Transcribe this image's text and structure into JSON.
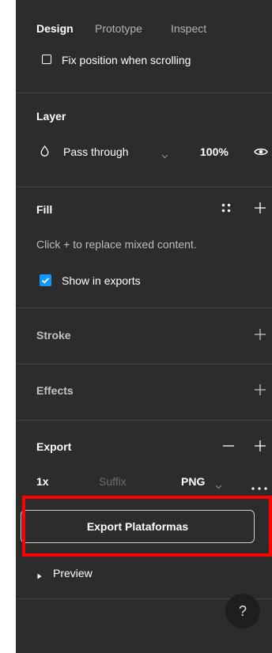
{
  "tabs": {
    "design": "Design",
    "prototype": "Prototype",
    "inspect": "Inspect"
  },
  "frame": {
    "fix_position_label": "Fix position when scrolling",
    "fix_position_checked": false
  },
  "layer": {
    "title": "Layer",
    "blend_mode": "Pass through",
    "opacity": "100%"
  },
  "fill": {
    "title": "Fill",
    "hint": "Click + to replace mixed content.",
    "show_in_exports_label": "Show in exports",
    "show_in_exports_checked": true
  },
  "stroke": {
    "title": "Stroke"
  },
  "effects": {
    "title": "Effects"
  },
  "export": {
    "title": "Export",
    "scale": "1x",
    "suffix_placeholder": "Suffix",
    "format": "PNG",
    "button_label": "Export Plataformas"
  },
  "preview": {
    "label": "Preview"
  },
  "help": {
    "label": "?"
  },
  "colors": {
    "panel_bg": "#2c2c2c",
    "accent": "#0d99ff",
    "highlight": "#ff0000"
  }
}
